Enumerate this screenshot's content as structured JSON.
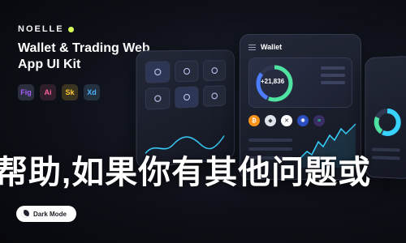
{
  "brand": {
    "name": "NOELLE"
  },
  "headline": "Wallet & Trading Web App UI Kit",
  "tools": [
    {
      "label": "Fig",
      "icon": "figma-icon"
    },
    {
      "label": "Ai",
      "icon": "illustrator-icon"
    },
    {
      "label": "Sk",
      "icon": "sketch-icon"
    },
    {
      "label": "Xd",
      "icon": "xd-icon"
    }
  ],
  "overlay_text": "帮助,如果你有其他问题或",
  "mode_toggle": {
    "label": "Dark Mode"
  },
  "phone_main": {
    "title": "Wallet",
    "balance": "+21,836"
  },
  "colors": {
    "accent_lime": "#d9ff57",
    "ring_green": "#4fe3a1",
    "ring_blue": "#4c7dff",
    "chart_cyan": "#38d2ff"
  }
}
